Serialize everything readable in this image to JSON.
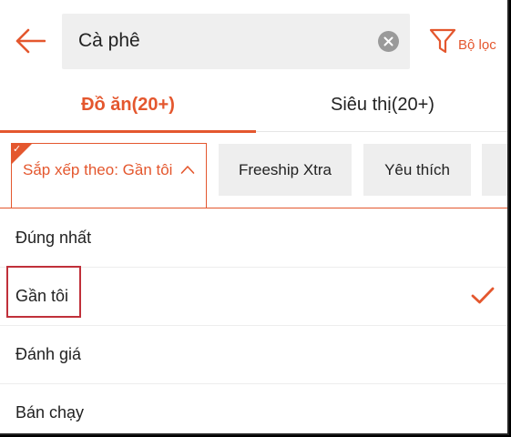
{
  "header": {
    "back_icon": "arrow-left-icon",
    "search_value": "Cà phê",
    "clear_icon": "clear-circle-icon",
    "filter_icon": "funnel-icon",
    "filter_label": "Bộ lọc"
  },
  "tabs": [
    {
      "label": "Đồ ăn(20+)",
      "active": true
    },
    {
      "label": "Siêu thị(20+)",
      "active": false
    }
  ],
  "chips": {
    "sort_label": "Sắp xếp theo: Gần tôi",
    "sort_icon": "chevron-up-icon",
    "freeship": "Freeship Xtra",
    "favorite": "Yêu thích"
  },
  "sort_options": [
    {
      "label": "Đúng nhất",
      "selected": false
    },
    {
      "label": "Gần tôi",
      "selected": true
    },
    {
      "label": "Đánh giá",
      "selected": false
    },
    {
      "label": "Bán chạy",
      "selected": false
    }
  ],
  "colors": {
    "accent": "#e4572e",
    "highlight_box": "#c0303a"
  }
}
